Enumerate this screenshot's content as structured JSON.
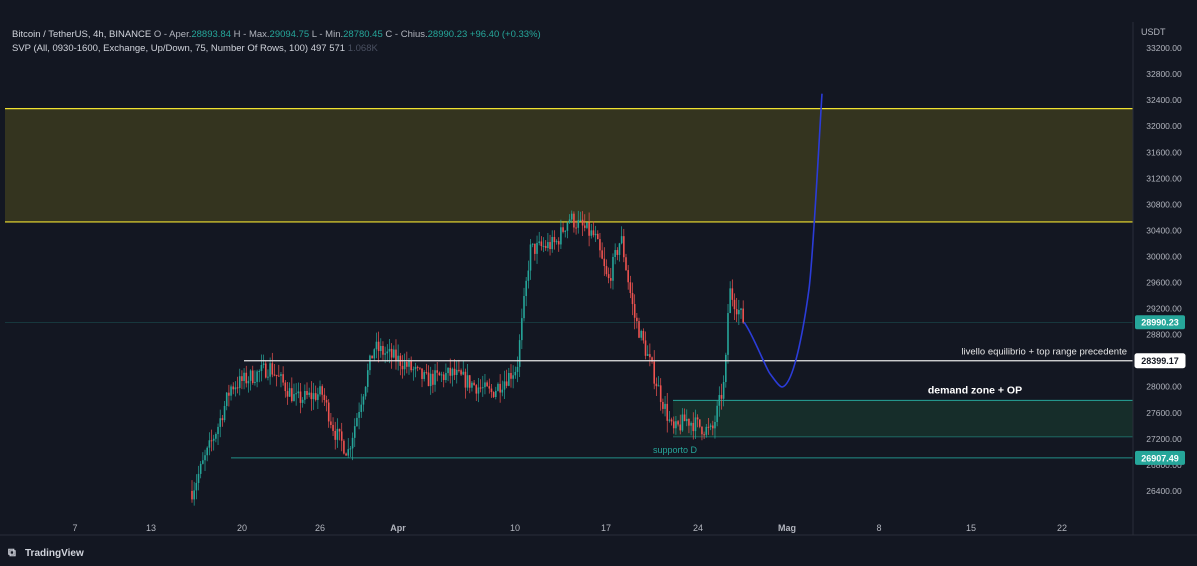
{
  "header": {
    "symbol": "Bitcoin / TetherUS, 4h, BINANCE",
    "open_label": "O",
    "open_value": "28893.84",
    "high_label": "H",
    "high_value": "29094.75",
    "low_label": "L",
    "low_value": "28780.45",
    "close_label": "C",
    "close_value": "28990.23",
    "change": "+96.40 (+0.33%)",
    "indicator": "SVP (All, 0930-1600, Exchange, Up/Down, 75, Number Of Rows, 100)",
    "indicator_v1": "497",
    "indicator_v2": "571",
    "indicator_v3": "1.068K"
  },
  "currency": "USDT",
  "footer": {
    "brand": "TradingView",
    "logo": "tradingview-logo"
  },
  "colors": {
    "background": "#131722",
    "up": "#26a69a",
    "down": "#ef5350",
    "zone_border": "#f0e130",
    "zone_fill": "#3b3a1e",
    "demand": "#26a69a",
    "projection": "#2b3cd8",
    "price_label": "#26a69a"
  },
  "chart_data": {
    "type": "candlestick",
    "x_ticks": [
      "7",
      "13",
      "20",
      "26",
      "Apr",
      "10",
      "17",
      "24",
      "Mag",
      "8",
      "15",
      "22"
    ],
    "y_ticks": [
      33200,
      32800,
      32400,
      32000,
      31600,
      31200,
      30800,
      30400,
      30000,
      29600,
      29200,
      28800,
      28400,
      28000,
      27600,
      27200,
      26800,
      26400
    ],
    "ylim": [
      26000,
      33400
    ],
    "price_labels": [
      {
        "value": 28990.23,
        "text": "28990.23",
        "style": "green"
      },
      {
        "value": 28399.17,
        "text": "28399.17",
        "style": "white"
      },
      {
        "value": 26907.49,
        "text": "26907.49",
        "style": "green"
      }
    ],
    "zones": [
      {
        "name": "supply",
        "from": 30530,
        "to": 32270
      },
      {
        "name": "demand",
        "from": 27230,
        "to": 27790
      }
    ],
    "lines": [
      {
        "name": "equilibrio",
        "value": 28399.17
      }
    ],
    "annotations": [
      {
        "text": "livello equilibrio + top range precedente"
      },
      {
        "text": "demand zone + OP"
      },
      {
        "text": "supporto D"
      }
    ],
    "anchors": [
      {
        "date": "Mar 16",
        "value": 26400
      },
      {
        "date": "Mar 17",
        "value": 26900
      },
      {
        "date": "Mar 18",
        "value": 27400
      },
      {
        "date": "Mar 19",
        "value": 28000
      },
      {
        "date": "Mar 21",
        "value": 28200
      },
      {
        "date": "Mar 22",
        "value": 28300
      },
      {
        "date": "Mar 24",
        "value": 27800
      },
      {
        "date": "Mar 26",
        "value": 27900
      },
      {
        "date": "Mar 27",
        "value": 27300
      },
      {
        "date": "Mar 28",
        "value": 27000
      },
      {
        "date": "Mar 30",
        "value": 28600
      },
      {
        "date": "Apr 1",
        "value": 28400
      },
      {
        "date": "Apr 3",
        "value": 28100
      },
      {
        "date": "Apr 5",
        "value": 28200
      },
      {
        "date": "Apr 8",
        "value": 27900
      },
      {
        "date": "Apr 10",
        "value": 28300
      },
      {
        "date": "Apr 11",
        "value": 30100
      },
      {
        "date": "Apr 13",
        "value": 30200
      },
      {
        "date": "Apr 14",
        "value": 30600
      },
      {
        "date": "Apr 16",
        "value": 30300
      },
      {
        "date": "Apr 17",
        "value": 29600
      },
      {
        "date": "Apr 18",
        "value": 30300
      },
      {
        "date": "Apr 19",
        "value": 29100
      },
      {
        "date": "Apr 20",
        "value": 28500
      },
      {
        "date": "Apr 21",
        "value": 27900
      },
      {
        "date": "Apr 22",
        "value": 27300
      },
      {
        "date": "Apr 23",
        "value": 27500
      },
      {
        "date": "Apr 24",
        "value": 27400
      },
      {
        "date": "Apr 25",
        "value": 27300
      },
      {
        "date": "Apr 26",
        "value": 28100
      },
      {
        "date": "Apr 26",
        "value": 29500
      },
      {
        "date": "Apr 27",
        "value": 28990
      }
    ],
    "projection": [
      {
        "date": "Apr 27",
        "value": 28990
      },
      {
        "date": "Apr 29",
        "value": 28200
      },
      {
        "date": "Apr 30",
        "value": 28000
      },
      {
        "date": "May 2",
        "value": 29500
      },
      {
        "date": "May 3",
        "value": 32500
      }
    ]
  }
}
